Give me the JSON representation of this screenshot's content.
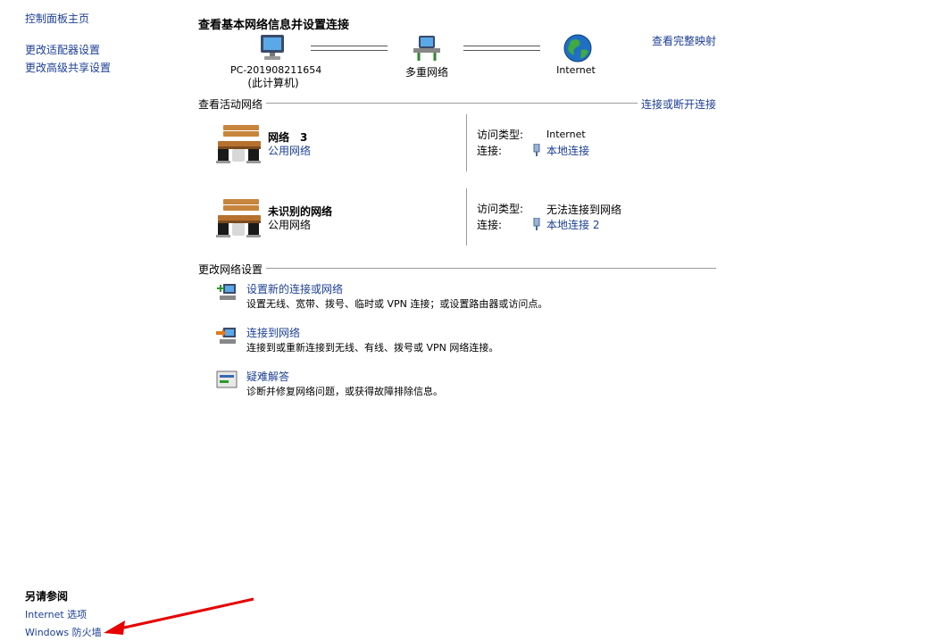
{
  "sidebar": {
    "home": "控制面板主页",
    "adapter": "更改适配器设置",
    "sharing": "更改高级共享设置",
    "see_also_title": "另请参阅",
    "see_also": [
      "Internet 选项",
      "Windows 防火墙"
    ]
  },
  "header": {
    "title": "查看基本网络信息并设置连接",
    "full_map": "查看完整映射"
  },
  "map": {
    "computer_name": "PC-201908211654",
    "computer_note": "(此计算机)",
    "middle": "多重网络",
    "internet": "Internet"
  },
  "active": {
    "title": "查看活动网络",
    "connect_link": "连接或断开连接",
    "networks": [
      {
        "name": "网络　3",
        "type": "公用网络",
        "access_label": "访问类型:",
        "access_value": "Internet",
        "conn_label": "连接:",
        "conn_value": "本地连接"
      },
      {
        "name": "未识别的网络",
        "type": "公用网络",
        "access_label": "访问类型:",
        "access_value": "无法连接到网络",
        "conn_label": "连接:",
        "conn_value": "本地连接 2"
      }
    ]
  },
  "change": {
    "title": "更改网络设置",
    "tasks": [
      {
        "title": "设置新的连接或网络",
        "desc": "设置无线、宽带、拨号、临时或 VPN 连接；或设置路由器或访问点。"
      },
      {
        "title": "连接到网络",
        "desc": "连接到或重新连接到无线、有线、拨号或 VPN 网络连接。"
      },
      {
        "title": "疑难解答",
        "desc": "诊断并修复网络问题，或获得故障排除信息。"
      }
    ]
  },
  "colors": {
    "link": "#1c3f94",
    "annotation_arrow": "#e60000"
  }
}
